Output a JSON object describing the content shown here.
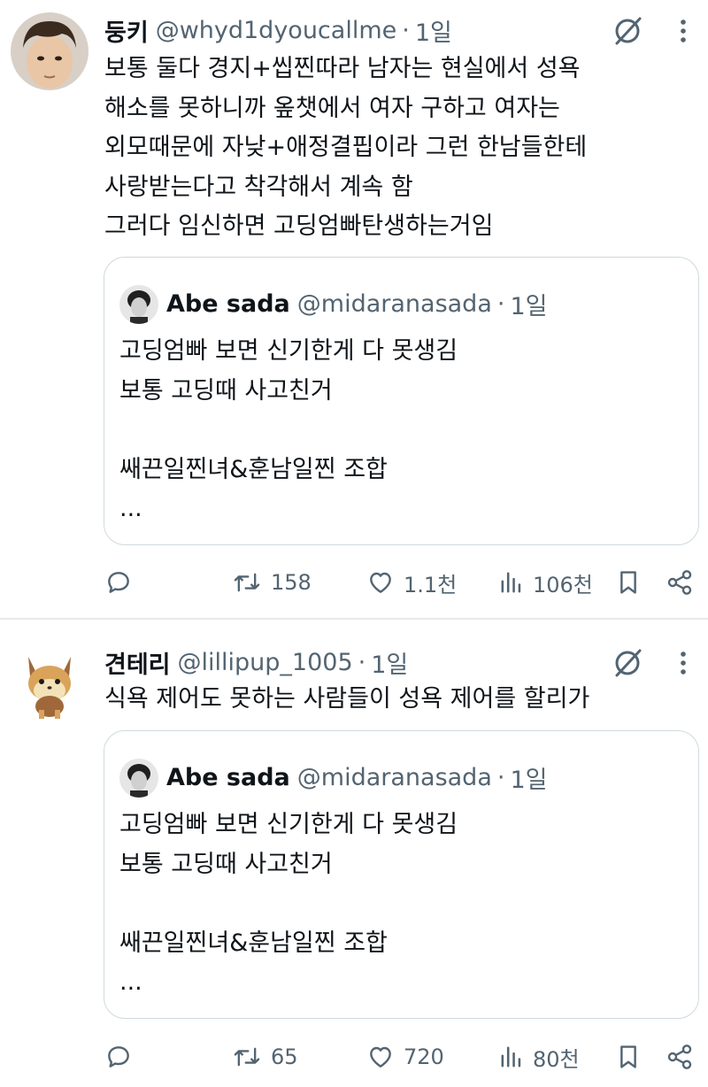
{
  "posts": [
    {
      "author_name": "둥키",
      "handle": "@whyd1dyoucallme",
      "separator": "·",
      "time": "1일",
      "text": "보통 둘다 경지+씹찐따라 남자는 현실에서 성욕\n해소를 못하니까 옾챗에서 여자 구하고 여자는\n외모때문에 자낮+애정결핍이라 그런 한남들한테\n사랑받는다고 착각해서 계속 함\n그러다 임신하면 고딩엄빠탄생하는거임",
      "quote": {
        "author_name": "Abe sada",
        "handle": "@midaranasada",
        "separator": "·",
        "time": "1일",
        "text": "고딩엄빠 보면 신기한게 다 못생김\n보통 고딩때 사고친거\n\n쌔끈일찐녀&훈남일찐 조합\n..."
      },
      "actions": {
        "replies": "",
        "reposts": "158",
        "likes": "1.1천",
        "views": "106천"
      }
    },
    {
      "author_name": "견테리",
      "handle": "@lillipup_1005",
      "separator": "·",
      "time": "1일",
      "text": "식욕 제어도 못하는 사람들이 성욕 제어를 할리가",
      "quote": {
        "author_name": "Abe sada",
        "handle": "@midaranasada",
        "separator": "·",
        "time": "1일",
        "text": "고딩엄빠 보면 신기한게 다 못생김\n보통 고딩때 사고친거\n\n쌔끈일찐녀&훈남일찐 조합\n..."
      },
      "actions": {
        "replies": "",
        "reposts": "65",
        "likes": "720",
        "views": "80천"
      }
    }
  ],
  "colors": {
    "text": "#0f1419",
    "secondary": "#536471",
    "border": "#cfd9de",
    "divider": "#e7e9eb"
  },
  "icons": [
    "grok-icon",
    "more-icon",
    "reply-icon",
    "repost-icon",
    "like-icon",
    "views-icon",
    "bookmark-icon",
    "share-icon"
  ]
}
